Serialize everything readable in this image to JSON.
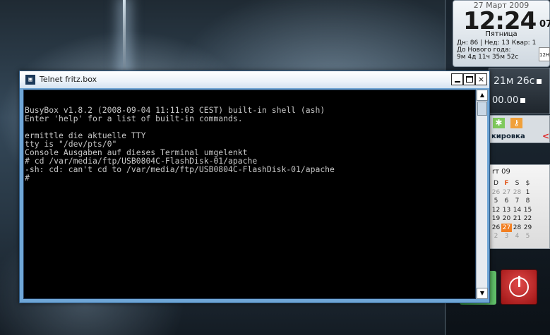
{
  "window": {
    "title": "Telnet fritz.box",
    "icon": "telnet-icon",
    "buttons": {
      "minimize": "minimize-icon",
      "maximize": "maximize-icon",
      "close": "×"
    }
  },
  "terminal": {
    "lines": [
      "BusyBox v1.8.2 (2008-09-04 11:11:03 CEST) built-in shell (ash)",
      "Enter 'help' for a list of built-in commands.",
      "",
      "ermittle die aktuelle TTY",
      "tty is \"/dev/pts/0\"",
      "Console Ausgaben auf dieses Terminal umgelenkt",
      "# cd /var/media/ftp/USB0804C-FlashDisk-01/apache",
      "-sh: cd: can't cd to /var/media/ftp/USB0804C-FlashDisk-01/apache",
      "#"
    ]
  },
  "scrollbar": {
    "up": "▲",
    "down": "▼"
  },
  "clock_gadget": {
    "date": "27 Март 2009",
    "time": "12:24",
    "seconds": "07",
    "weekday": "Пятница",
    "info_line1": "Дн: 86 | Нед: 13 Квар: 1",
    "info_line2": "До Нового года:",
    "info_line3": "9м  4д  11ч 35м  52с",
    "button": "12H"
  },
  "dark_gadget": {
    "line1": "21м 26с",
    "line2": "00.00"
  },
  "icon_gadget": {
    "label": "кировка",
    "green_icon": "✱",
    "orange_icon": "🔑",
    "arrow": "<"
  },
  "calendar": {
    "month": "rт 09",
    "headers": [
      "D",
      "F",
      "S",
      "$"
    ],
    "rows": [
      [
        "26",
        "27",
        "28",
        "1"
      ],
      [
        "5",
        "6",
        "7",
        "8"
      ],
      [
        "12",
        "13",
        "14",
        "15"
      ],
      [
        "19",
        "20",
        "21",
        "22"
      ],
      [
        "26",
        "27",
        "28",
        "29"
      ],
      [
        "2",
        "3",
        "4",
        "5"
      ]
    ]
  },
  "colors": {
    "terminal_bg": "#000000",
    "terminal_fg": "#c7c7c7",
    "window_frame": "#6fa6d6",
    "today": "#f27f22"
  }
}
